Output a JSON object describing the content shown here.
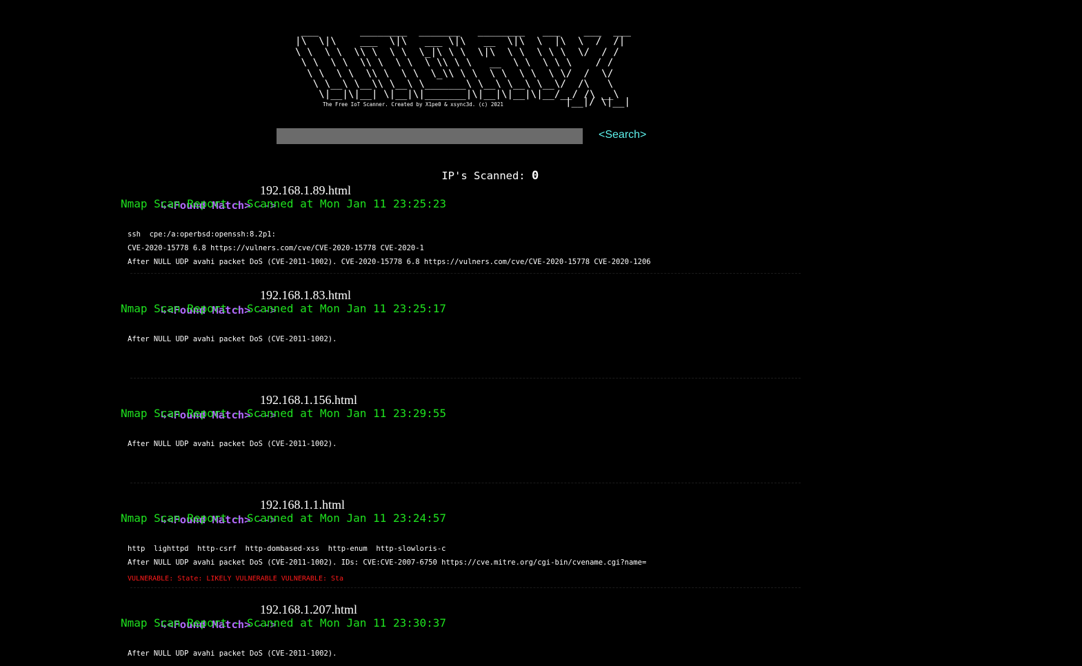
{
  "logo": {
    "art": " ___       ________  _______   ________   ___    ___  ___\n|\\  \\|\\    ___  \\|\\   ___ \\|\\   __  \\|\\  \\  |\\  \\  /  /|\n\\ \\  \\ \\  \\\\ \\  \\ \\  \\_|\\ \\ \\  \\|\\  \\ \\  \\ \\ \\  \\/  / /\n \\ \\  \\ \\  \\\\ \\  \\ \\  \\ \\\\ \\ \\   __  \\ \\  \\ \\ \\    / /\n  \\ \\  \\ \\  \\\\ \\  \\ \\  \\_\\\\ \\ \\  \\ \\  \\ \\  \\ \\/  /  \\/\n   \\ \\__\\ \\__\\\\ \\__\\ \\_______\\ \\__\\ \\__\\ \\__\\/  /\\   \\\n    \\|__|\\|__| \\|__|\\|_______|\\|__|\\|__|\\|__/__/ /\\ __\\",
    "art_tail": "|__|/ \\|__|",
    "tagline": "The Free IoT Scanner. Created by X1pe0 & xsync3d. (c) 2021"
  },
  "search": {
    "placeholder": "",
    "value": "",
    "link_label": "<Search>"
  },
  "counter": {
    "label": "IP's Scanned: ",
    "value": "0"
  },
  "results": [
    {
      "arrow_label": "↳<Found Match>",
      "separator": " -->",
      "filename": "192.168.1.89.html",
      "report": "Nmap Scan Report - Scanned at Mon Jan 11 23:25:23",
      "lines": [
        "ssh  cpe:/a:operbsd:openssh:8.2p1:",
        "CVE-2020-15778 6.8 https://vulners.com/cve/CVE-2020-15778 CVE-2020-1",
        "After NULL UDP avahi packet DoS (CVE-2011-1002). CVE-2020-15778 6.8 https://vulners.com/cve/CVE-2020-15778 CVE-2020-1206"
      ]
    },
    {
      "arrow_label": "↳<Found Match>",
      "separator": " -->",
      "filename": "192.168.1.83.html",
      "report": "Nmap Scan Report - Scanned at Mon Jan 11 23:25:17",
      "lines": [
        "After NULL UDP avahi packet DoS (CVE-2011-1002)."
      ]
    },
    {
      "arrow_label": "↳<Found Match>",
      "separator": " -->",
      "filename": "192.168.1.156.html",
      "report": "Nmap Scan Report - Scanned at Mon Jan 11 23:29:55",
      "lines": [
        "After NULL UDP avahi packet DoS (CVE-2011-1002)."
      ]
    },
    {
      "arrow_label": "↳<Found Match>",
      "separator": " -->",
      "filename": "192.168.1.1.html",
      "report": "Nmap Scan Report - Scanned at Mon Jan 11 23:24:57",
      "lines": [
        "http  lighttpd  http-csrf  http-dombased-xss  http-enum  http-slowloris-c",
        "After NULL UDP avahi packet DoS (CVE-2011-1002). IDs: CVE:CVE-2007-6750 https://cve.mitre.org/cgi-bin/cvename.cgi?name="
      ],
      "vuln_line": "VULNERABLE: State: LIKELY VULNERABLE VULNERABLE: Sta"
    },
    {
      "arrow_label": "↳<Found Match>",
      "separator": " -->",
      "filename": "192.168.1.207.html",
      "report": "Nmap Scan Report - Scanned at Mon Jan 11 23:30:37",
      "lines": [
        "After NULL UDP avahi packet DoS (CVE-2011-1002)."
      ]
    }
  ],
  "colors": {
    "background": "#000000",
    "match_label": "#b36bff",
    "report": "#1fe21f",
    "search_link": "#5ef2ec",
    "search_box": "#6b6b6b",
    "vulnerable": "#ff1a1a",
    "text": "#ffffff"
  }
}
